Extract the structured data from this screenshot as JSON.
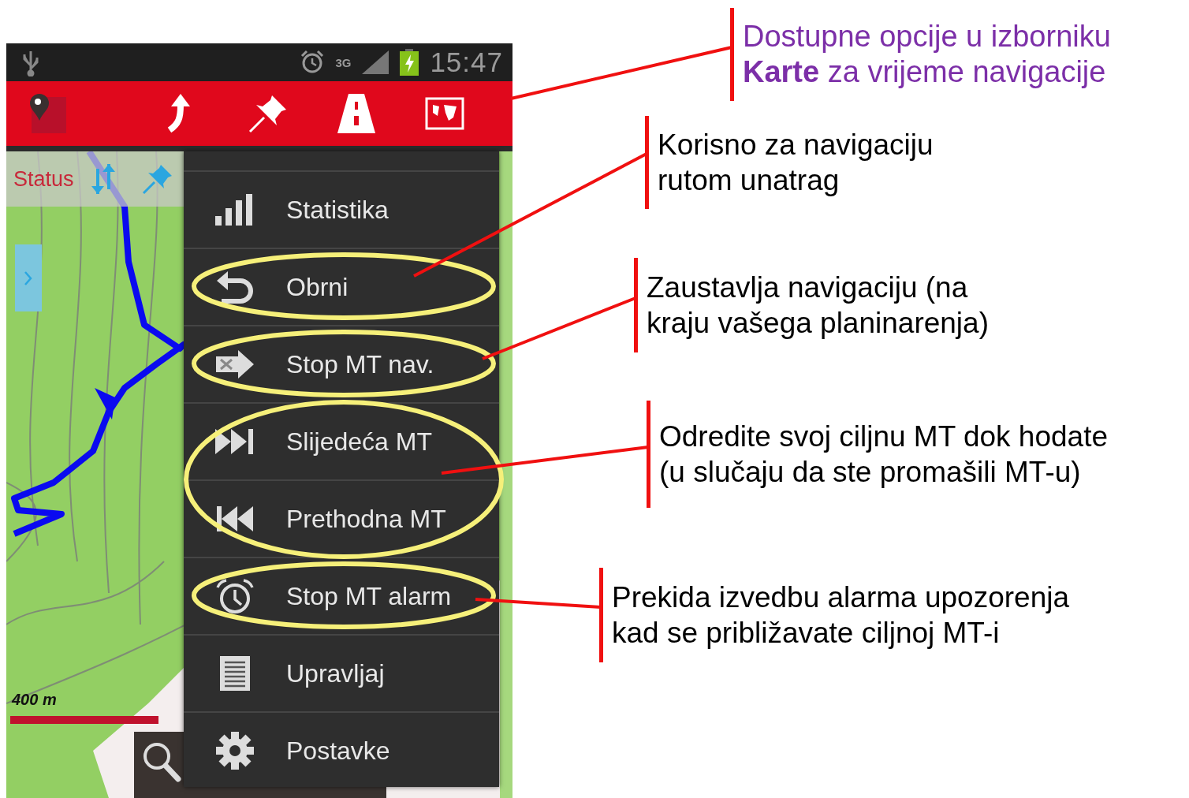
{
  "status_bar": {
    "network": "3G",
    "time": "15:47"
  },
  "map": {
    "kind": "picture",
    "status_label": "Status",
    "scale_label": "400 m"
  },
  "menu": {
    "items": [
      {
        "label": "Statistika",
        "kind": "stats",
        "highlighted": false
      },
      {
        "label": "Obrni",
        "kind": "reverse",
        "highlighted": true
      },
      {
        "label": "Stop MT nav.",
        "kind": "stopnav",
        "highlighted": true
      },
      {
        "label": "Slijedeća MT",
        "kind": "next",
        "highlighted": true
      },
      {
        "label": "Prethodna MT",
        "kind": "previous",
        "highlighted": true
      },
      {
        "label": "Stop MT alarm",
        "kind": "alarm",
        "highlighted": true
      },
      {
        "label": "Upravljaj",
        "kind": "manage",
        "highlighted": false
      },
      {
        "label": "Postavke",
        "kind": "settings",
        "highlighted": false
      }
    ]
  },
  "callouts": [
    {
      "text": "Dostupne opcije u izborniku **Karte** za vrijeme navigacije",
      "color": "#7c2fa8"
    },
    {
      "text": "Korisno za navigaciju rutom unatrag",
      "color": "#000000"
    },
    {
      "text": "Zaustavlja navigaciju (na kraju vašega planinarenja)",
      "color": "#000000"
    },
    {
      "text": "Odredite svoj ciljnu MT dok hodate (u slučaju da ste promašili MT-u)",
      "color": "#000000"
    },
    {
      "text": "Prekida izvedbu alarma upozorenja kad se približavate ciljnoj MT-i",
      "color": "#000000"
    }
  ]
}
